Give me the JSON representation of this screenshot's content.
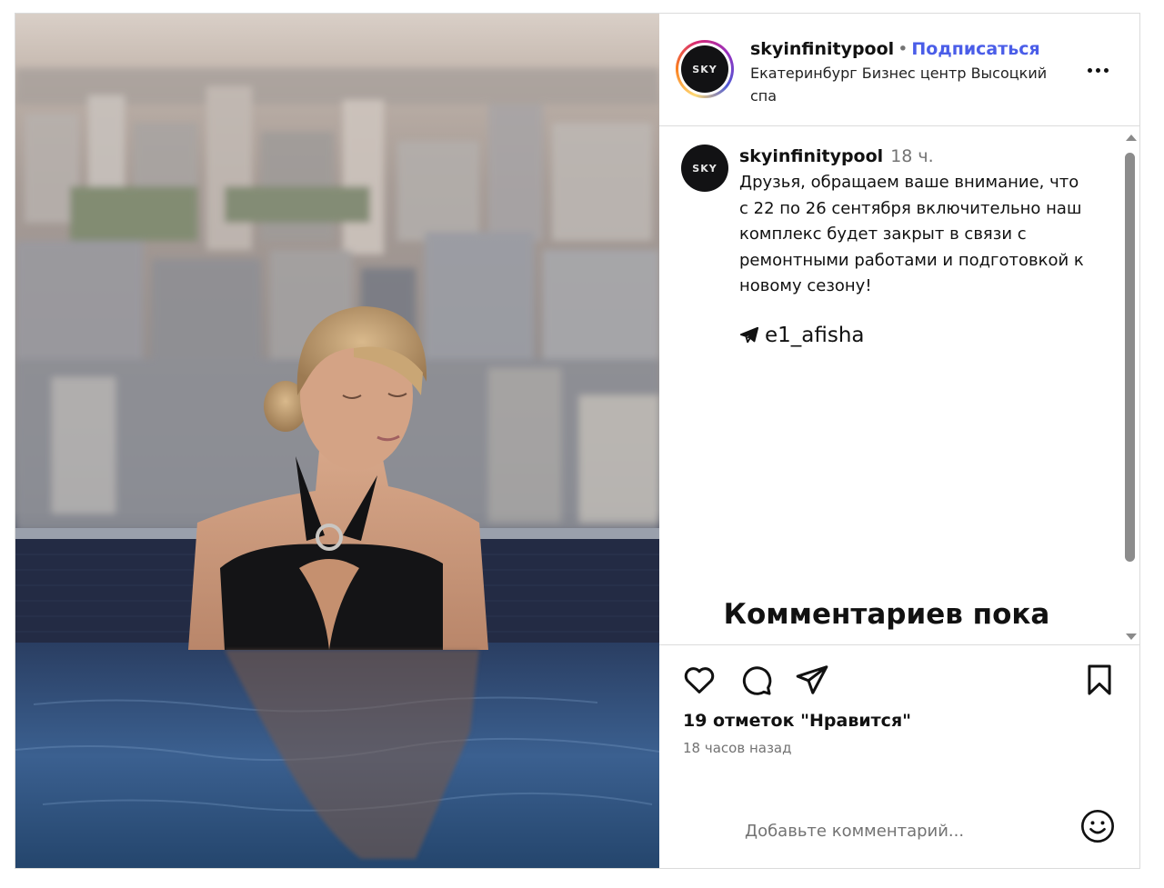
{
  "post": {
    "username": "skyinfinitypool",
    "separator": "•",
    "follow_label": "Подписаться",
    "location": "Екатеринбург Бизнес центр Высоцкий спа",
    "avatar_text": "SKY",
    "more_icon": "more-horizontal-icon"
  },
  "caption": {
    "username": "skyinfinitypool",
    "time": "18 ч.",
    "text": "Друзья, обращаем ваше внимание, что с 22 по 26 сентября включительно наш комплекс будет закрыт в связи с ремонтными работами и подготовкой к новому сезону!",
    "source_icon": "telegram-icon",
    "source": "e1_afisha"
  },
  "comments": {
    "empty_text": "Комментариев пока"
  },
  "actions": {
    "icons": [
      "heart-icon",
      "comment-icon",
      "share-icon",
      "bookmark-icon"
    ],
    "likes": "19 отметок \"Нравится\"",
    "time_ago": "18 часов назад"
  },
  "add_comment": {
    "placeholder": "Добавьте комментарий...",
    "emoji_icon": "emoji-icon"
  },
  "photo": {
    "description_icon": "post-photo"
  },
  "colors": {
    "follow": "#4a5de8",
    "border": "#dbdbdb",
    "muted": "#737373"
  }
}
